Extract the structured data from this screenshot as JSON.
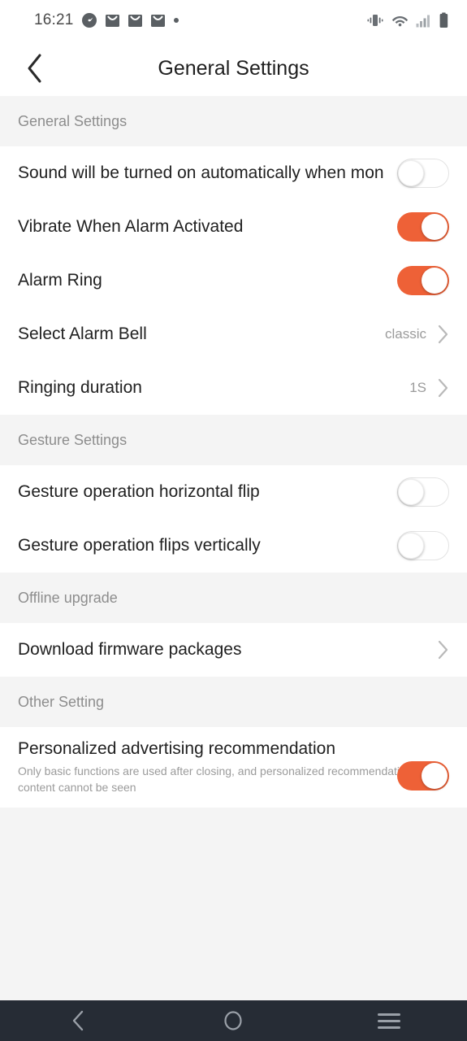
{
  "status_bar": {
    "time": "16:21",
    "left_icons": [
      "speedometer-icon",
      "mail-icon",
      "mail-icon",
      "mail-icon",
      "dot-icon"
    ],
    "right_icons": [
      "vibrate-icon",
      "wifi-icon",
      "signal-icon",
      "battery-icon"
    ]
  },
  "app_bar": {
    "back_label": "back-chevron",
    "title": "General Settings"
  },
  "colors": {
    "accent": "#ee6137",
    "page_bg": "#f4f4f4",
    "row_bg": "#ffffff",
    "nav_bg": "#262c35",
    "label": "#212121",
    "muted": "#9b9b9b",
    "section_label": "#8d8d8d"
  },
  "sections": [
    {
      "header": "General Settings",
      "rows": [
        {
          "label": "Sound will be turned on automatically when mon",
          "type": "toggle",
          "state": "off",
          "overlap": true
        },
        {
          "label": "Vibrate When Alarm Activated",
          "type": "toggle",
          "state": "on"
        },
        {
          "label": "Alarm Ring",
          "type": "toggle",
          "state": "on"
        },
        {
          "label": "Select Alarm Bell",
          "type": "value",
          "value": "classic"
        },
        {
          "label": "Ringing duration",
          "type": "value",
          "value": "1S"
        }
      ]
    },
    {
      "header": "Gesture Settings",
      "rows": [
        {
          "label": "Gesture operation horizontal flip",
          "type": "toggle",
          "state": "off"
        },
        {
          "label": "Gesture operation flips vertically",
          "type": "toggle",
          "state": "off"
        }
      ]
    },
    {
      "header": "Offline upgrade",
      "rows": [
        {
          "label": "Download firmware packages",
          "type": "chevron"
        }
      ]
    },
    {
      "header": "Other Setting",
      "rows": [
        {
          "label": "Personalized advertising recommendation",
          "subtitle": "Only basic functions are used after closing, and personalized recommendation content cannot be seen",
          "type": "toggle",
          "state": "on"
        }
      ]
    }
  ],
  "nav_bar": {
    "back": "back-icon",
    "home": "home-icon",
    "recents": "recents-icon"
  }
}
